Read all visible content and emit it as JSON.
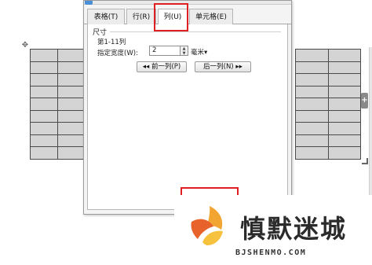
{
  "dialog": {
    "tabs": [
      {
        "label": "表格(T)"
      },
      {
        "label": "行(R)"
      },
      {
        "label": "列(U)"
      },
      {
        "label": "单元格(E)"
      }
    ],
    "active_tab": "列(U)",
    "group_title": "尺寸",
    "column_range": "第1-11列",
    "width_label": "指定宽度(W):",
    "width_value": "2",
    "unit": "毫米",
    "prev_button": "前一列(P)",
    "next_button": "后一列(N)"
  },
  "document": {
    "left_table": {
      "rows": 9,
      "cols": 2
    },
    "right_table": {
      "rows": 9,
      "cols": 2
    },
    "cell_color": "#d4d4d4"
  },
  "annotations": {
    "highlight_color": "#e02020"
  },
  "watermark": {
    "text": "慎默迷城",
    "url": "BJSHENMO.COM"
  }
}
